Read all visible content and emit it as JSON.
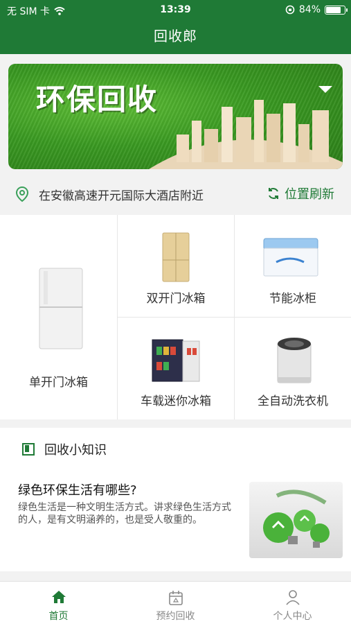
{
  "status_bar": {
    "carrier": "无 SIM 卡",
    "time": "13:39",
    "battery_percent_label": "84%",
    "battery_level": 0.84
  },
  "header": {
    "title": "回收郎"
  },
  "banner": {
    "title": "环保回收"
  },
  "location": {
    "address": "在安徽高速开元国际大酒店附近",
    "refresh_label": "位置刷新"
  },
  "categories": [
    {
      "label": "单开门冰箱",
      "icon": "single-door-fridge-icon"
    },
    {
      "label": "双开门冰箱",
      "icon": "double-door-fridge-icon"
    },
    {
      "label": "节能冰柜",
      "icon": "chest-freezer-icon"
    },
    {
      "label": "车载迷你冰箱",
      "icon": "mini-fridge-icon"
    },
    {
      "label": "全自动洗衣机",
      "icon": "washing-machine-icon"
    }
  ],
  "knowledge": {
    "section_title": "回收小知识",
    "article_title": "绿色环保生活有哪些?",
    "article_desc": "绿色生活是一种文明生活方式。讲求绿色生活方式的人，是有文明涵养的，也是受人敬重的。"
  },
  "tabbar": {
    "items": [
      {
        "label": "首页",
        "icon": "home-icon",
        "active": true
      },
      {
        "label": "预约回收",
        "icon": "calendar-icon",
        "active": false
      },
      {
        "label": "个人中心",
        "icon": "person-icon",
        "active": false
      }
    ]
  },
  "colors": {
    "primary": "#1f7a36",
    "background": "#f2f2f2"
  }
}
